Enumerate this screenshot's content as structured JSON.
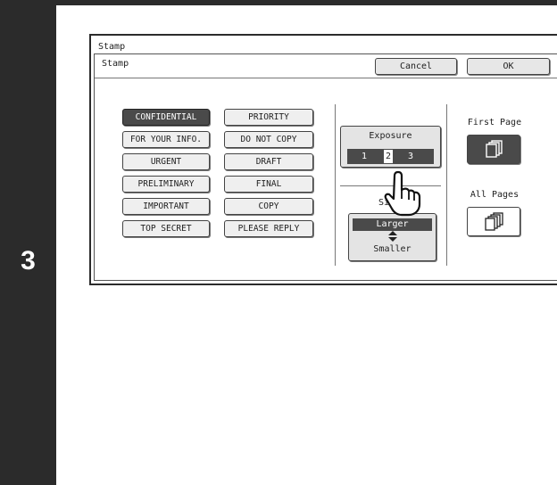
{
  "step": {
    "number": "3"
  },
  "window": {
    "title": "Stamp"
  },
  "section": {
    "title": "Stamp"
  },
  "header": {
    "cancel_label": "Cancel",
    "ok_label": "OK"
  },
  "stamps": {
    "left": [
      "CONFIDENTIAL",
      "FOR YOUR INFO.",
      "URGENT",
      "PRELIMINARY",
      "IMPORTANT",
      "TOP SECRET"
    ],
    "right": [
      "PRIORITY",
      "DO NOT COPY",
      "DRAFT",
      "FINAL",
      "COPY",
      "PLEASE REPLY"
    ],
    "selected": "CONFIDENTIAL"
  },
  "exposure": {
    "label": "Exposure",
    "levels": [
      "1",
      "2",
      "3"
    ],
    "selected_level": "2"
  },
  "size": {
    "caption": "Si",
    "larger_label": "Larger",
    "arrows": "▲\n▼",
    "smaller_label": "Smaller",
    "selected": "Larger"
  },
  "pages": {
    "first_label": "First Page",
    "all_label": "All Pages",
    "selected": "First Page"
  },
  "icons": {
    "cursor": "hand-pointer-icon",
    "page": "page-stack-icon"
  },
  "colors": {
    "frame": "#2b2b2b",
    "selected": "#4a4a4a",
    "button": "#efefef"
  }
}
